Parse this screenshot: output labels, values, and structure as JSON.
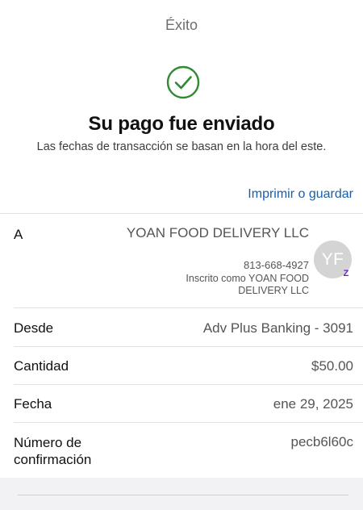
{
  "nav": {
    "title": "Éxito"
  },
  "icons": {
    "success": "check-circle-icon",
    "avatar_badge": "zelle-icon"
  },
  "colors": {
    "success": "#2e8b30",
    "link": "#1a5ea8",
    "zelle": "#6d1ed4"
  },
  "confirmation": {
    "headline": "Su pago fue enviado",
    "subtitle": "Las fechas de transacción se basan en la hora del este."
  },
  "actions": {
    "print_or_save": "Imprimir o guardar"
  },
  "recipient": {
    "label": "A",
    "name": "YOAN FOOD DELIVERY LLC",
    "phone": "813-668-4927",
    "enrolled_as": "Inscrito como YOAN FOOD DELIVERY LLC",
    "avatar_initials": "YF",
    "badge": "Z"
  },
  "details": {
    "from_label": "Desde",
    "from_value": "Adv Plus Banking - 3091",
    "amount_label": "Cantidad",
    "amount_value": "$50.00",
    "date_label": "Fecha",
    "date_value": "ene 29, 2025",
    "confirmation_label": "Número de confirmación",
    "confirmation_value": "pecb6l60c"
  }
}
